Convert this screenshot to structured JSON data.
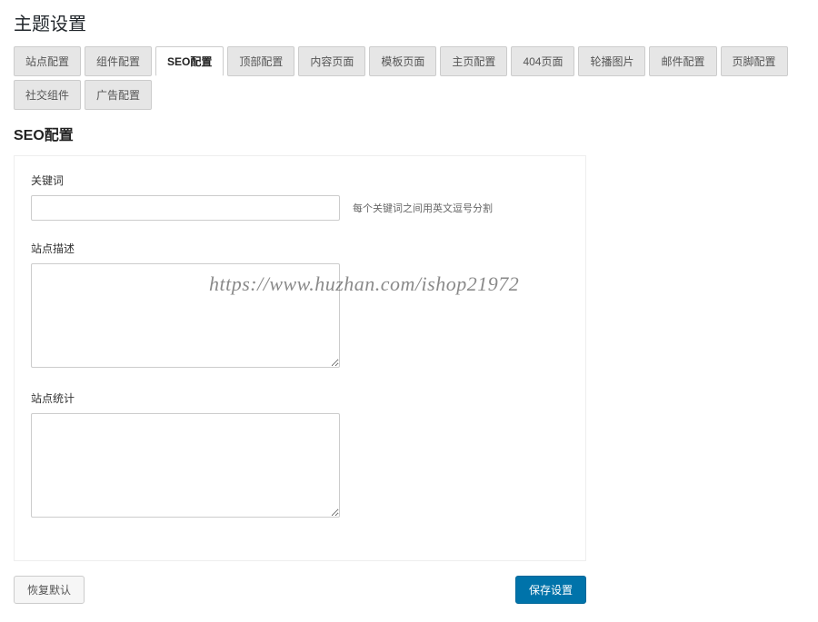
{
  "page_title": "主题设置",
  "tabs": [
    {
      "label": "站点配置",
      "active": false
    },
    {
      "label": "组件配置",
      "active": false
    },
    {
      "label": "SEO配置",
      "active": true
    },
    {
      "label": "顶部配置",
      "active": false
    },
    {
      "label": "内容页面",
      "active": false
    },
    {
      "label": "模板页面",
      "active": false
    },
    {
      "label": "主页配置",
      "active": false
    },
    {
      "label": "404页面",
      "active": false
    },
    {
      "label": "轮播图片",
      "active": false
    },
    {
      "label": "邮件配置",
      "active": false
    },
    {
      "label": "页脚配置",
      "active": false
    },
    {
      "label": "社交组件",
      "active": false
    },
    {
      "label": "广告配置",
      "active": false
    }
  ],
  "section_title": "SEO配置",
  "fields": {
    "keywords": {
      "label": "关键词",
      "value": "",
      "hint": "每个关键词之间用英文逗号分割"
    },
    "description": {
      "label": "站点描述",
      "value": ""
    },
    "stats": {
      "label": "站点统计",
      "value": ""
    }
  },
  "actions": {
    "reset": "恢复默认",
    "save": "保存设置"
  },
  "watermark": "https://www.huzhan.com/ishop21972"
}
